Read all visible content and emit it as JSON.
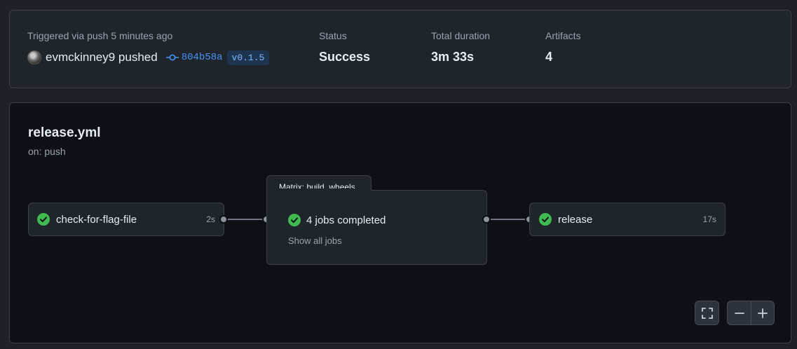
{
  "summary": {
    "trigger_label": "Triggered via push 5 minutes ago",
    "actor": "evmckinney9 pushed",
    "commit_sha": "804b58a",
    "tag": "v0.1.5",
    "status_label": "Status",
    "status_value": "Success",
    "duration_label": "Total duration",
    "duration_value": "3m 33s",
    "artifacts_label": "Artifacts",
    "artifacts_value": "4"
  },
  "workflow": {
    "title": "release.yml",
    "trigger": "on: push"
  },
  "jobs": [
    {
      "name": "check-for-flag-file",
      "duration": "2s",
      "status": "success"
    },
    {
      "name": "release",
      "duration": "17s",
      "status": "success"
    }
  ],
  "matrix": {
    "label": "Matrix: build_wheels",
    "summary": "4 jobs completed",
    "link": "Show all jobs"
  },
  "colors": {
    "success": "#3fb950",
    "link": "#4493f8"
  },
  "icons": {
    "fullscreen": "fullscreen-icon",
    "zoom_out": "minus-icon",
    "zoom_in": "plus-icon",
    "commit": "git-commit-icon",
    "check": "check-circle-icon"
  }
}
